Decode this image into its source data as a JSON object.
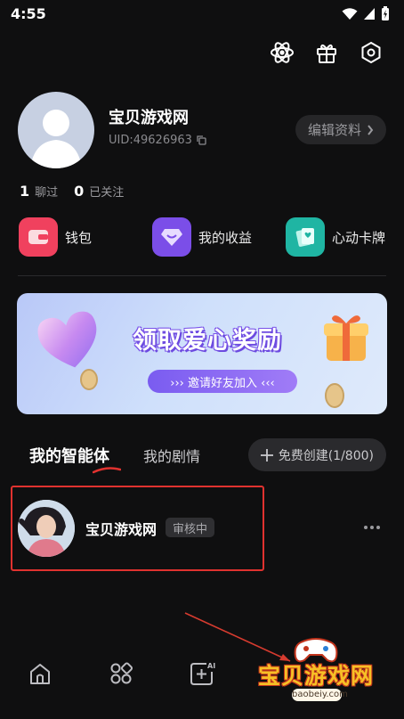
{
  "status_bar": {
    "time": "4:55"
  },
  "profile": {
    "name": "宝贝游戏网",
    "uid": "UID:49626963",
    "edit_label": "编辑资料",
    "stats": [
      {
        "value": "1",
        "label": "聊过"
      },
      {
        "value": "0",
        "label": "已关注"
      }
    ]
  },
  "features": [
    {
      "label": "钱包",
      "icon": "wallet-icon",
      "color": "#f0415e"
    },
    {
      "label": "我的收益",
      "icon": "diamond-icon",
      "color": "#7b4ee8"
    },
    {
      "label": "心动卡牌",
      "icon": "card-icon",
      "color": "#1fb5a3"
    }
  ],
  "banner": {
    "title": "领取爱心奖励",
    "subtitle": "››› 邀请好友加入 ‹‹‹"
  },
  "tabs": {
    "active": "我的智能体",
    "other": "我的剧情",
    "create_label": "免费创建(1/800)"
  },
  "agent": {
    "name": "宝贝游戏网",
    "status": "审核中"
  },
  "watermark": {
    "text": "宝贝游戏网",
    "url": "baobeiy.com"
  },
  "colors": {
    "background": "#0f0f10",
    "highlight_border": "#e0322f",
    "accent_purple": "#7b4ee8"
  }
}
